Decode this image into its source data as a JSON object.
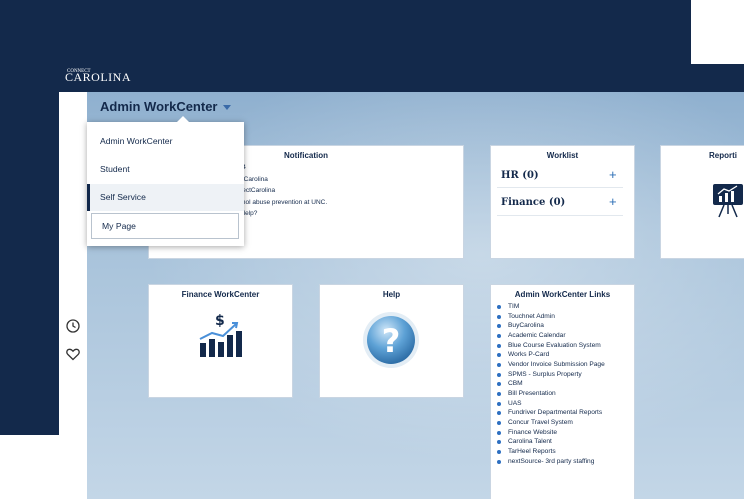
{
  "brand": {
    "logo_small": "CONNECT",
    "logo_text": "CAROLINA"
  },
  "header": {
    "workcenter_title": "Admin WorkCenter"
  },
  "dropdown": {
    "items": [
      "Admin WorkCenter",
      "Student",
      "Self Service",
      "My Page"
    ],
    "selected": "Self Service"
  },
  "notification": {
    "title": "Notification",
    "lines": [
      "024",
      "ectCarolina",
      "nnectCarolina",
      "cohol abuse prevention at UNC.",
      "n Help?"
    ]
  },
  "worklist": {
    "title": "Worklist",
    "rows": [
      {
        "label": "HR (0)",
        "action": "+"
      },
      {
        "label": "Finance (0)",
        "action": "+"
      }
    ]
  },
  "reporting": {
    "title": "Reporti"
  },
  "finance_workcenter": {
    "title": "Finance WorkCenter"
  },
  "help": {
    "title": "Help"
  },
  "admin_links": {
    "title": "Admin WorkCenter Links",
    "items": [
      "TIM",
      "Touchnet Admin",
      "BuyCarolina",
      "Academic Calendar",
      "Blue Course Evaluation System",
      "Works P-Card",
      "Vendor Invoice Submission Page",
      "SPMS - Surplus Property",
      "CBM",
      "Bill Presentation",
      "UAS",
      "Fundriver Departmental Reports",
      "Concur Travel System",
      "Finance Website",
      "Carolina Talent",
      "TarHeel Reports",
      "nextSource- 3rd party staffing"
    ]
  },
  "icons": [
    "clock-icon",
    "heart-icon",
    "finance-chart-icon",
    "help-question-icon",
    "reporting-presentation-icon"
  ],
  "colors": {
    "navy": "#13294b",
    "accent_blue": "#2d6fc1",
    "background": "#d4e2ee"
  }
}
